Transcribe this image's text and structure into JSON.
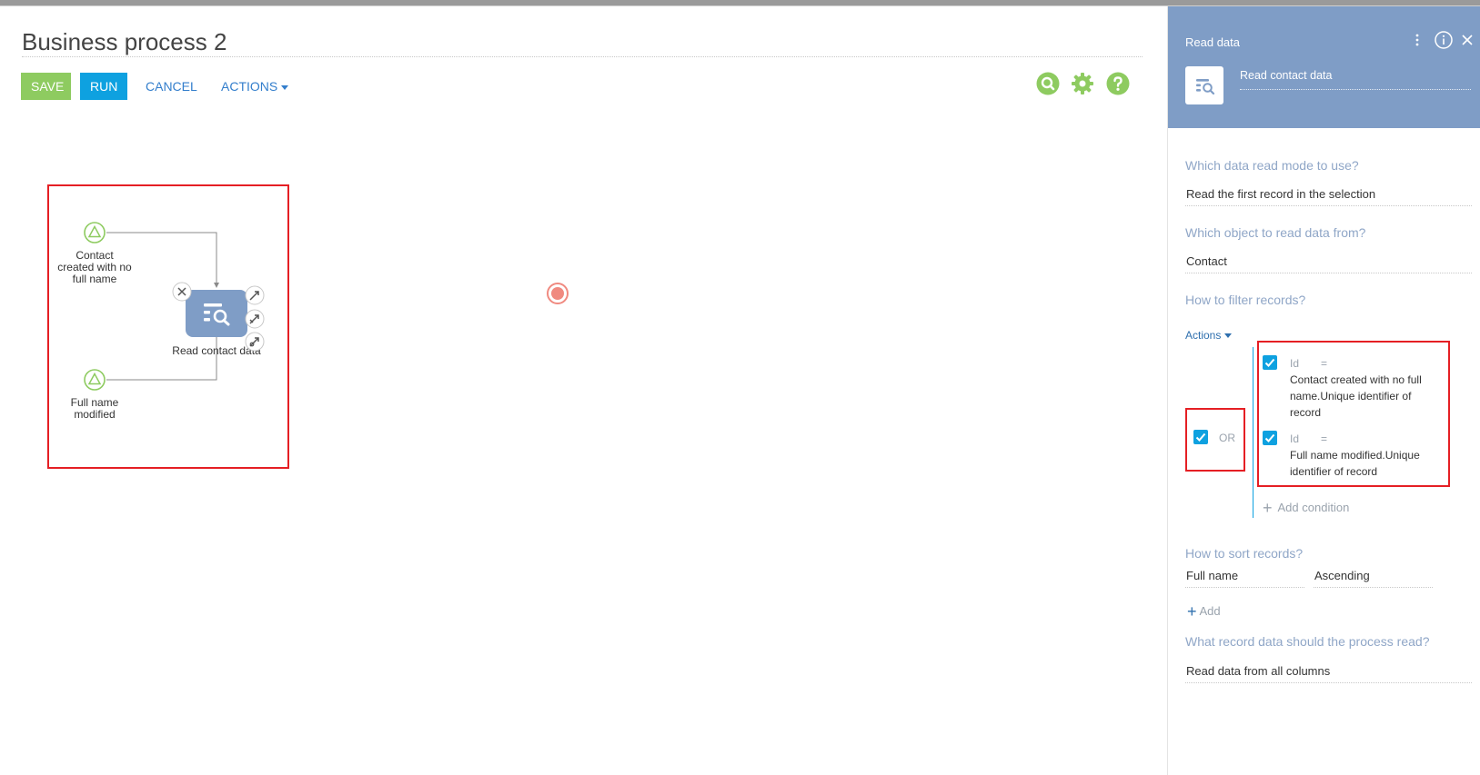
{
  "header": {
    "title": "Business process 2",
    "save_label": "SAVE",
    "run_label": "RUN",
    "cancel_label": "CANCEL",
    "actions_label": "ACTIONS"
  },
  "toolbar_icons": [
    "search-icon",
    "gear-icon",
    "help-icon"
  ],
  "diagram": {
    "start_event_1_label": "Contact created with no full name",
    "start_event_2_label": "Full name modified",
    "task_label": "Read contact data"
  },
  "panel": {
    "header_title": "Read data",
    "element_name": "Read contact data",
    "q_read_mode": "Which data read mode to use?",
    "read_mode_value": "Read the first record in the selection",
    "q_object": "Which object to read data from?",
    "object_value": "Contact",
    "q_filter": "How to filter records?",
    "filter_actions_label": "Actions",
    "group_operator": "OR",
    "conditions": [
      {
        "column": "Id",
        "operator": "=",
        "value": "Contact created with no full name.Unique identifier of record"
      },
      {
        "column": "Id",
        "operator": "=",
        "value": "Full name modified.Unique identifier of record"
      }
    ],
    "add_condition_label": "Add condition",
    "q_sort": "How to sort records?",
    "sort_column": "Full name",
    "sort_direction": "Ascending",
    "add_sort_label": "Add",
    "q_columns": "What record data should the process read?",
    "columns_value": "Read data from all columns"
  },
  "colors": {
    "accent_blue": "#0ea1e0",
    "save_green": "#8ecb60",
    "panel_header": "#7f9dc6",
    "highlight_red": "#e51f24"
  }
}
